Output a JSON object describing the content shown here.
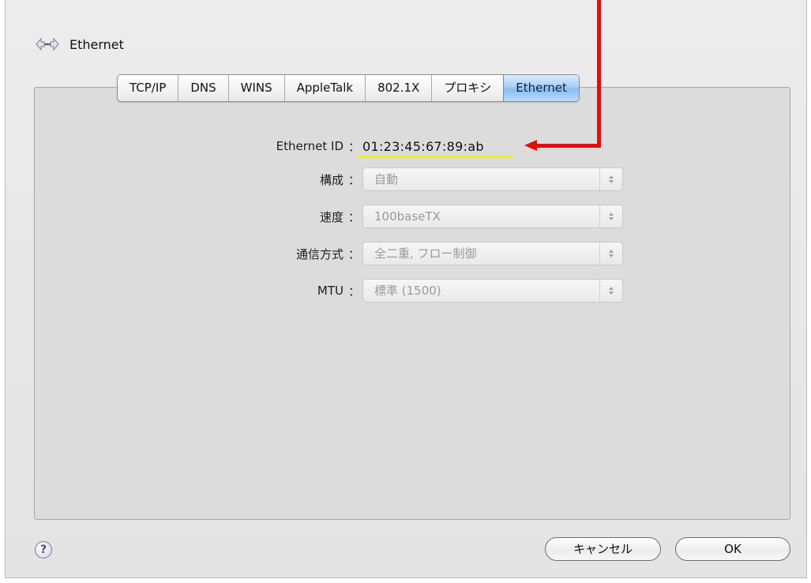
{
  "window": {
    "title": "Ethernet",
    "icon": "network-globe-icon"
  },
  "tabs": [
    {
      "label": "TCP/IP",
      "active": false
    },
    {
      "label": "DNS",
      "active": false
    },
    {
      "label": "WINS",
      "active": false
    },
    {
      "label": "AppleTalk",
      "active": false
    },
    {
      "label": "802.1X",
      "active": false
    },
    {
      "label": "プロキシ",
      "active": false
    },
    {
      "label": "Ethernet",
      "active": true
    }
  ],
  "form": {
    "ethernet_id": {
      "label": "Ethernet ID",
      "value": "01:23:45:67:89:ab"
    },
    "config": {
      "label": "構成",
      "value": "自動"
    },
    "speed": {
      "label": "速度",
      "value": "100baseTX"
    },
    "duplex": {
      "label": "通信方式",
      "value": "全二重, フロー制御"
    },
    "mtu": {
      "label": "MTU",
      "value": "標準 (1500)"
    },
    "colon": "："
  },
  "footer": {
    "help": "?",
    "cancel": "キャンセル",
    "ok": "OK"
  },
  "colors": {
    "annotation_arrow": "#e20e0e",
    "highlight_underline": "#f4ea1f",
    "active_tab": "#86bcf2"
  }
}
